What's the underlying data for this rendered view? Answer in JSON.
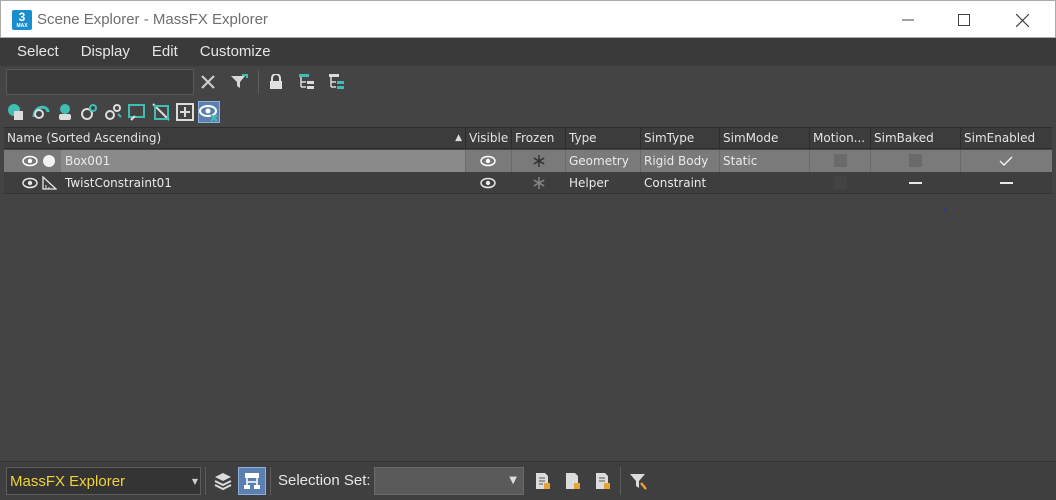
{
  "window": {
    "app_icon_text": "3",
    "app_icon_sub": "MAX",
    "title": "Scene Explorer - MassFX Explorer"
  },
  "menu": {
    "items": [
      "Select",
      "Display",
      "Edit",
      "Customize"
    ]
  },
  "search": {
    "value": "",
    "placeholder": ""
  },
  "table": {
    "sort_indicator": "▲",
    "columns": [
      "Name (Sorted Ascending)",
      "Visible",
      "Frozen",
      "Type",
      "SimType",
      "SimMode",
      "Motion...",
      "SimBaked",
      "SimEnabled"
    ],
    "rows": [
      {
        "name": "Box001",
        "object_icon": "sphere-icon",
        "visible": true,
        "frozen": false,
        "type": "Geometry",
        "simtype": "Rigid Body",
        "simmode": "Static",
        "motion": "disabled",
        "simbaked": "disabled",
        "simenabled": "checked",
        "selected": true
      },
      {
        "name": "TwistConstraint01",
        "object_icon": "helper-icon",
        "visible": true,
        "frozen": false,
        "type": "Helper",
        "simtype": "Constraint",
        "simmode": "",
        "motion": "disabled",
        "simbaked": "indeterminate",
        "simenabled": "indeterminate",
        "selected": false
      }
    ]
  },
  "bottom": {
    "explorer_name": "MassFX Explorer",
    "selection_set_label": "Selection Set:",
    "selection_set_value": ""
  },
  "colors": {
    "accent": "#5b7fb0",
    "explorer_text": "#f0d23a",
    "teal_icon": "#3fbfb3"
  }
}
